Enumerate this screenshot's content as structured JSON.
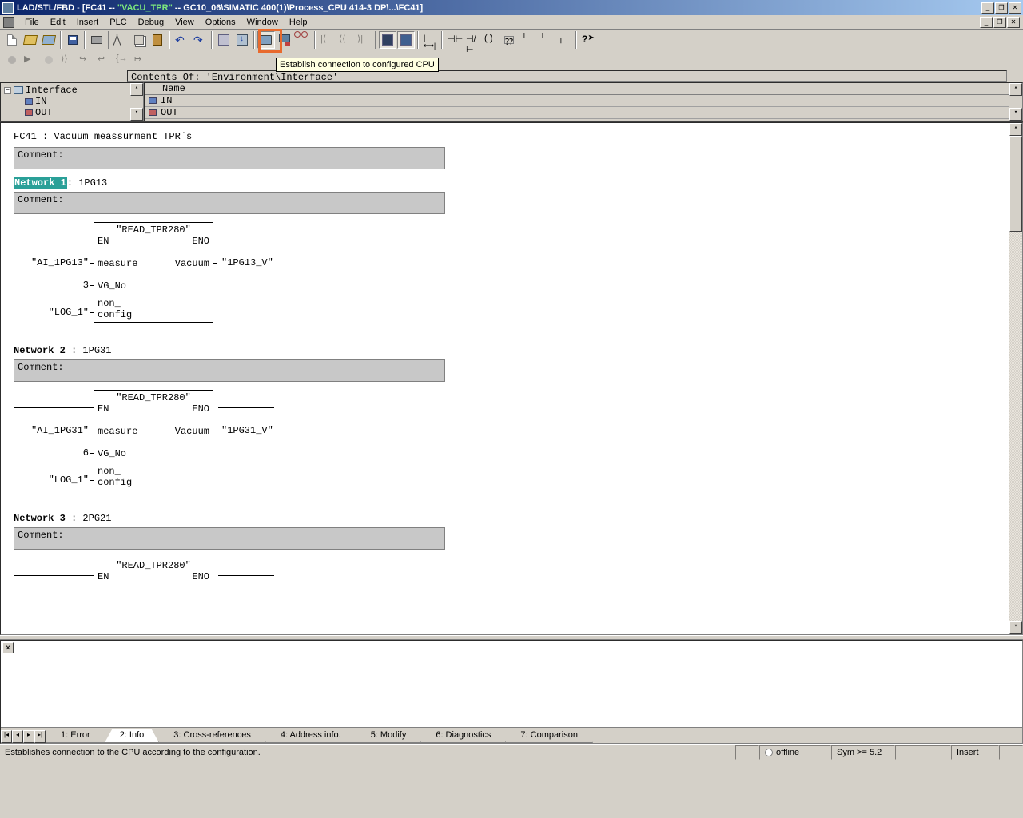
{
  "titlebar": {
    "app": "LAD/STL/FBD",
    "sep": "  - ",
    "doc_open": "[FC41 -- ",
    "doc_quote": "\"VACU_TPR\"",
    "doc_rest": " -- GC10_06\\SIMATIC 400(1)\\Process_CPU 414-3 DP\\...\\FC41]"
  },
  "menu": {
    "file": "File",
    "edit": "Edit",
    "insert": "Insert",
    "plc": "PLC",
    "debug": "Debug",
    "view": "View",
    "options": "Options",
    "window": "Window",
    "help": "Help"
  },
  "tooltip": "Establish connection to configured CPU",
  "contents_label": "Contents Of: 'Environment\\Interface'",
  "tree": {
    "root": "Interface",
    "in": "IN",
    "out": "OUT"
  },
  "name_header": "Name",
  "name_rows": [
    "IN",
    "OUT"
  ],
  "editor": {
    "block_title": "FC41 : Vacuum meassurment TPR´s",
    "comment_label": "Comment:",
    "networks": [
      {
        "num": "Network 1",
        "title": ": 1PG13",
        "fb": "\"READ_TPR280\"",
        "en": "EN",
        "eno": "ENO",
        "ports_left": [
          {
            "name": "measure",
            "conn": "\"AI_1PG13\""
          },
          {
            "name": "VG_No",
            "conn": "3"
          },
          {
            "name": "non_\nconfig",
            "conn": "\"LOG_1\""
          }
        ],
        "ports_right": [
          {
            "name": "Vacuum",
            "conn": "\"1PG13_V\""
          }
        ]
      },
      {
        "num": "Network 2",
        "title": " : 1PG31",
        "fb": "\"READ_TPR280\"",
        "en": "EN",
        "eno": "ENO",
        "ports_left": [
          {
            "name": "measure",
            "conn": "\"AI_1PG31\""
          },
          {
            "name": "VG_No",
            "conn": "6"
          },
          {
            "name": "non_\nconfig",
            "conn": "\"LOG_1\""
          }
        ],
        "ports_right": [
          {
            "name": "Vacuum",
            "conn": "\"1PG31_V\""
          }
        ]
      },
      {
        "num": "Network 3",
        "title": " : 2PG21",
        "fb": "\"READ_TPR280\"",
        "en": "EN",
        "eno": "ENO"
      }
    ]
  },
  "tabs": {
    "t1": "1: Error",
    "t2": "2: Info",
    "t3": "3: Cross-references",
    "t4": "4: Address info.",
    "t5": "5: Modify",
    "t6": "6: Diagnostics",
    "t7": "7: Comparison"
  },
  "status": {
    "hint": "Establishes connection to the CPU according to the configuration.",
    "offline": "offline",
    "sym": "Sym >= 5.2",
    "insert": "Insert"
  }
}
